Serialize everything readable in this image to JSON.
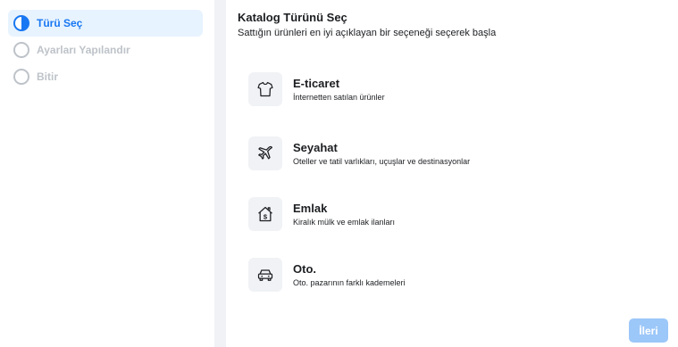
{
  "sidebar": {
    "steps": [
      {
        "label": "Türü Seç",
        "state": "active"
      },
      {
        "label": "Ayarları Yapılandır",
        "state": "pending"
      },
      {
        "label": "Bitir",
        "state": "pending"
      }
    ]
  },
  "main": {
    "title": "Katalog Türünü Seç",
    "subtitle": "Sattığın ürünleri en iyi açıklayan bir seçeneği seçerek başla",
    "options": [
      {
        "name": "E-ticaret",
        "description": "İnternetten satılan ürünler",
        "icon": "tshirt-icon"
      },
      {
        "name": "Seyahat",
        "description": "Oteller ve tatil varlıkları, uçuşlar ve destinasyonlar",
        "icon": "airplane-icon"
      },
      {
        "name": "Emlak",
        "description": "Kiralık mülk ve emlak ilanları",
        "icon": "house-dollar-icon"
      },
      {
        "name": "Oto.",
        "description": "Oto. pazarının farklı kademeleri",
        "icon": "car-icon"
      }
    ],
    "next_label": "İleri"
  },
  "colors": {
    "accent": "#1877f2",
    "accent_light": "#e7f3ff",
    "disabled_button": "#9cc7f9",
    "background": "#f0f2f5"
  }
}
